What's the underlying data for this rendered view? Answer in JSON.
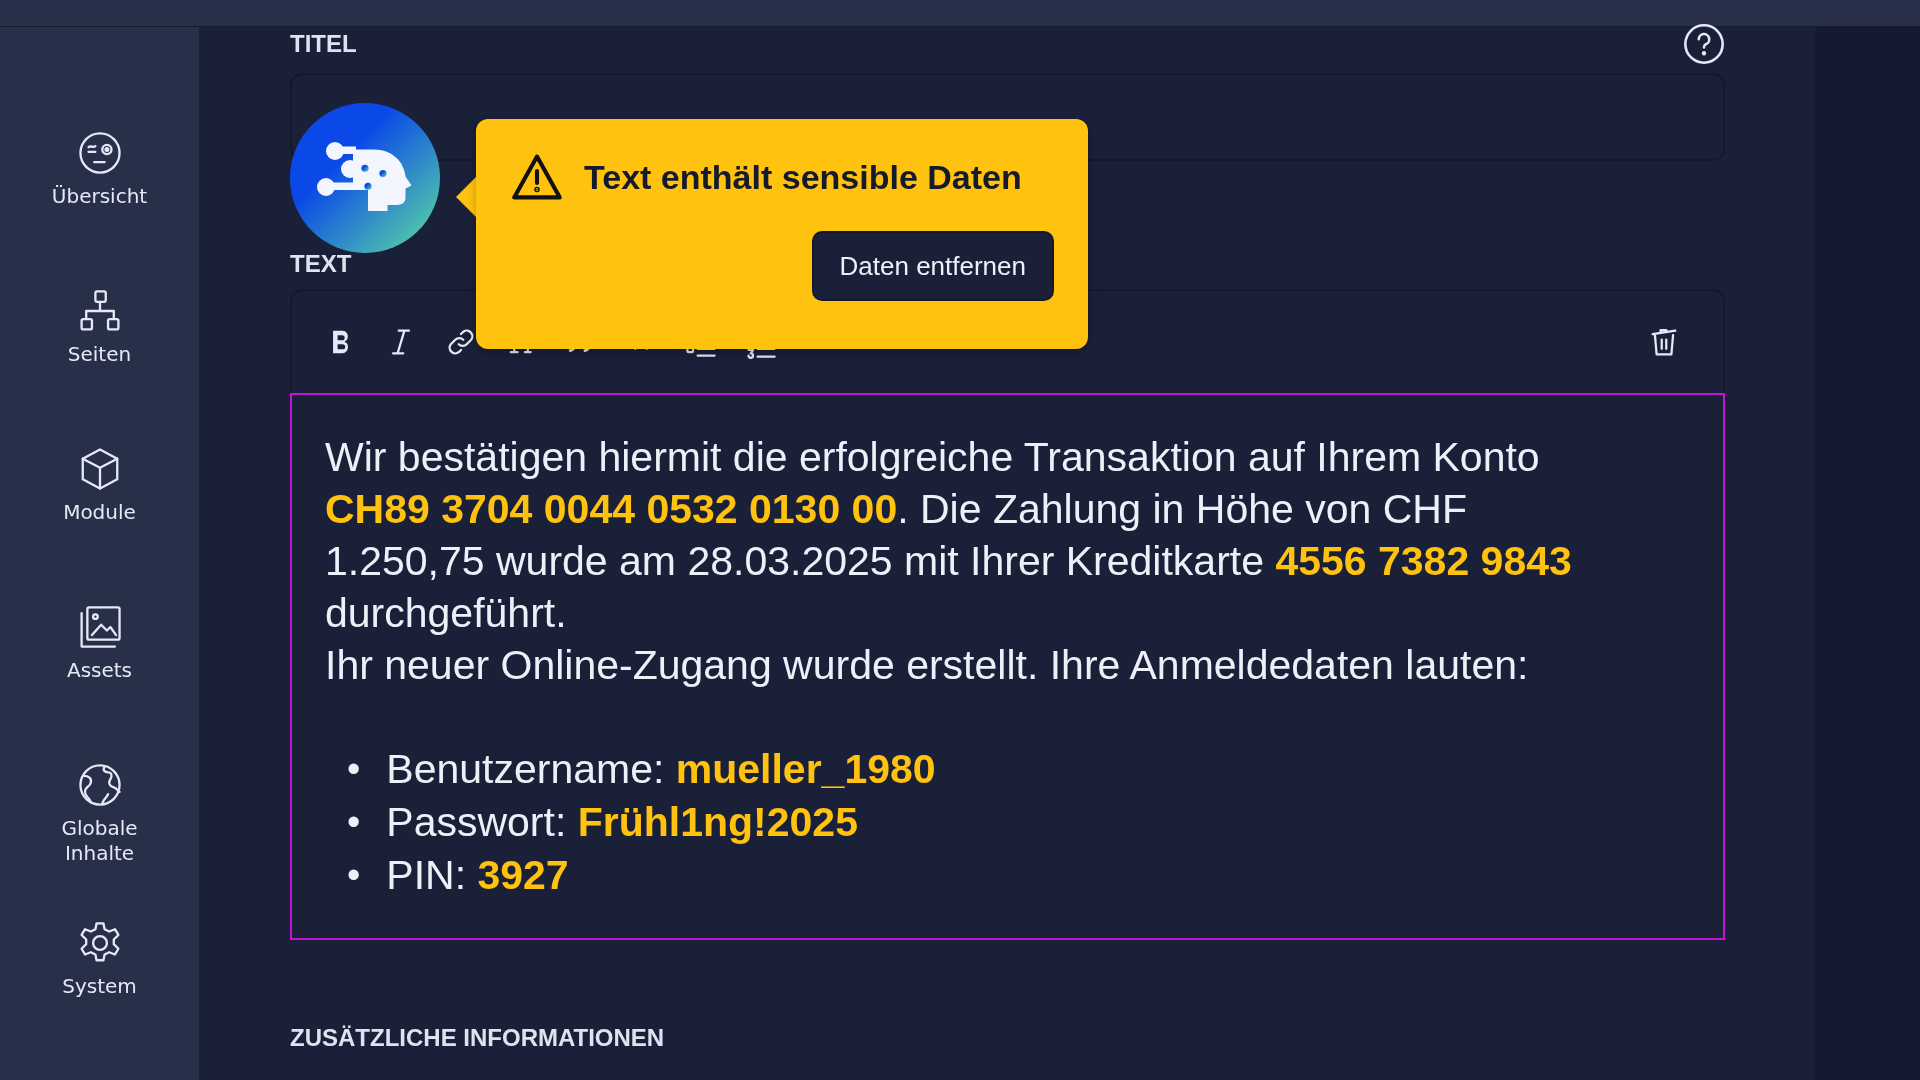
{
  "sidebar": {
    "items": [
      {
        "label": "Übersicht",
        "kind": "overview"
      },
      {
        "label": "Seiten",
        "kind": "sitemap"
      },
      {
        "label": "Module",
        "kind": "cube"
      },
      {
        "label": "Assets",
        "kind": "images"
      },
      {
        "label": "Globale Inhalte",
        "kind": "globe"
      },
      {
        "label": "System",
        "kind": "gear"
      }
    ]
  },
  "title_field": {
    "label": "TITEL"
  },
  "text_field": {
    "label": "TEXT",
    "toolbar": [
      {
        "kind": "bold"
      },
      {
        "kind": "italic"
      },
      {
        "kind": "link"
      },
      {
        "kind": "text-size"
      },
      {
        "kind": "quote"
      },
      {
        "kind": "code"
      },
      {
        "kind": "bullet-list"
      },
      {
        "kind": "numbered-list"
      }
    ],
    "content": {
      "paragraphs": [
        "Wir bestätigen hiermit die erfolgreiche Transaktion auf Ihrem Konto **CH89 3704 0044 0532 0130 00**. Die Zahlung in Höhe von CHF 1.250,75 wurde am 28.03.2025 mit Ihrer Kreditkarte **4556 7382 9843** durchgeführt.",
        "Ihr neuer Online-Zugang wurde erstellt. Ihre Anmeldedaten lauten:"
      ],
      "list": [
        {
          "marker": "•",
          "text": "Benutzername: **mueller_1980**"
        },
        {
          "marker": "•",
          "text": "Passwort: **Frühl1ng!2025**"
        },
        {
          "marker": "•",
          "text": "PIN: **3927**"
        }
      ]
    }
  },
  "warning_popup": {
    "message": "Text enthält sensible Daten",
    "button": "Daten entfernen"
  },
  "section_heading": "ZUSÄTZLICHE INFORMATIONEN"
}
